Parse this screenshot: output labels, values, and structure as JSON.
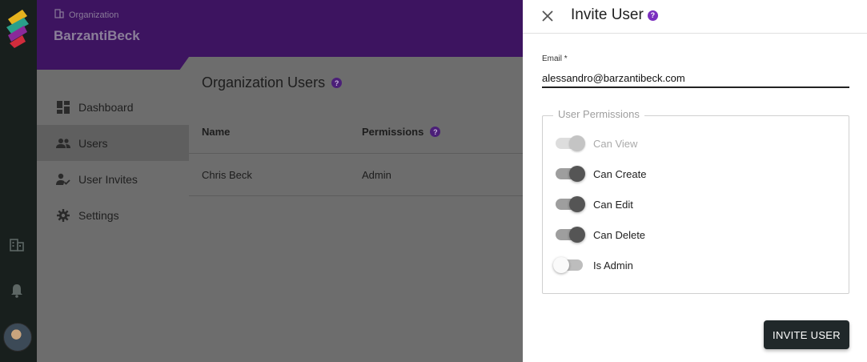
{
  "org": {
    "caption": "Organization",
    "name": "BarzantiBeck"
  },
  "nav": {
    "items": [
      {
        "label": "Dashboard",
        "icon": "dashboard-icon"
      },
      {
        "label": "Users",
        "icon": "people-icon",
        "active": true
      },
      {
        "label": "User Invites",
        "icon": "person-check-icon"
      },
      {
        "label": "Settings",
        "icon": "gear-icon"
      }
    ]
  },
  "content": {
    "title": "Organization Users",
    "columns": [
      "Name",
      "Permissions"
    ],
    "rows": [
      {
        "name": "Chris Beck",
        "permissions": "Admin"
      }
    ]
  },
  "drawer": {
    "title": "Invite User",
    "email_label": "Email *",
    "email_value": "alessandro@barzantibeck.com",
    "permissions_legend": "User Permissions",
    "permissions": [
      {
        "label": "Can View",
        "checked": true,
        "disabled": true
      },
      {
        "label": "Can Create",
        "checked": true,
        "disabled": false
      },
      {
        "label": "Can Edit",
        "checked": true,
        "disabled": false
      },
      {
        "label": "Can Delete",
        "checked": true,
        "disabled": false
      },
      {
        "label": "Is Admin",
        "checked": false,
        "disabled": false
      }
    ],
    "submit_label": "INVITE USER"
  },
  "colors": {
    "org_header": "#3d1460",
    "help_accent": "#7b2fbf",
    "button_bg": "#20282a",
    "rail_bg": "#181f1d"
  }
}
